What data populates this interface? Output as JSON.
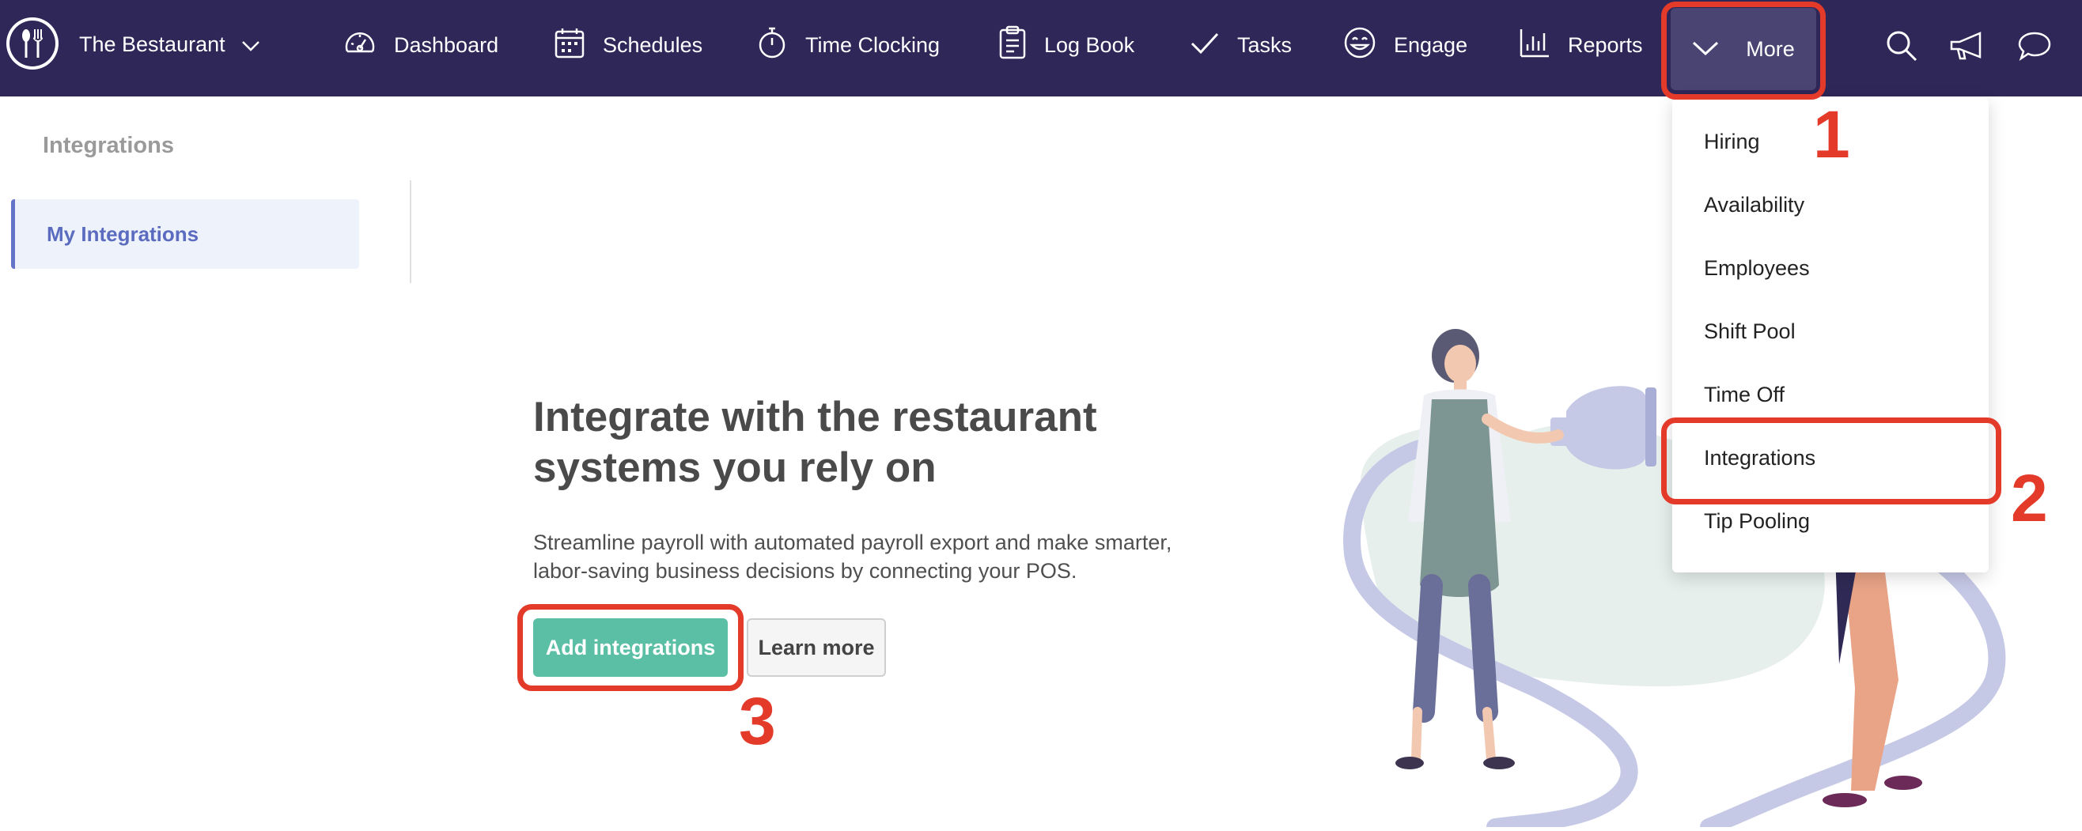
{
  "header": {
    "brand": "The Bestaurant",
    "nav": [
      {
        "label": "Dashboard",
        "icon": "gauge-icon"
      },
      {
        "label": "Schedules",
        "icon": "calendar-icon"
      },
      {
        "label": "Time Clocking",
        "icon": "stopwatch-icon"
      },
      {
        "label": "Log Book",
        "icon": "clipboard-icon"
      },
      {
        "label": "Tasks",
        "icon": "checkmark-icon"
      },
      {
        "label": "Engage",
        "icon": "smiley-icon"
      },
      {
        "label": "Reports",
        "icon": "bar-chart-icon"
      }
    ],
    "more_label": "More",
    "utility_icons": [
      "search-icon",
      "megaphone-icon",
      "chat-bubble-icon"
    ]
  },
  "sidebar": {
    "title": "Integrations",
    "items": [
      {
        "label": "My Integrations",
        "active": true
      }
    ]
  },
  "main": {
    "headline": "Integrate with the restaurant systems you rely on",
    "description": "Streamline payroll with automated payroll export and make smarter, labor-saving business decisions by connecting your POS.",
    "primary_button": "Add integrations",
    "secondary_button": "Learn more"
  },
  "more_menu": {
    "items": [
      "Hiring",
      "Availability",
      "Employees",
      "Shift Pool",
      "Time Off",
      "Integrations",
      "Tip Pooling"
    ]
  },
  "annotations": {
    "step1": "1",
    "step2": "2",
    "step3": "3"
  },
  "colors": {
    "navbar": "#2e2757",
    "more_active": "#4a4472",
    "primary_button": "#5bbfa6",
    "annotation": "#e33a2a",
    "sidebar_active_text": "#5b6cc0"
  }
}
